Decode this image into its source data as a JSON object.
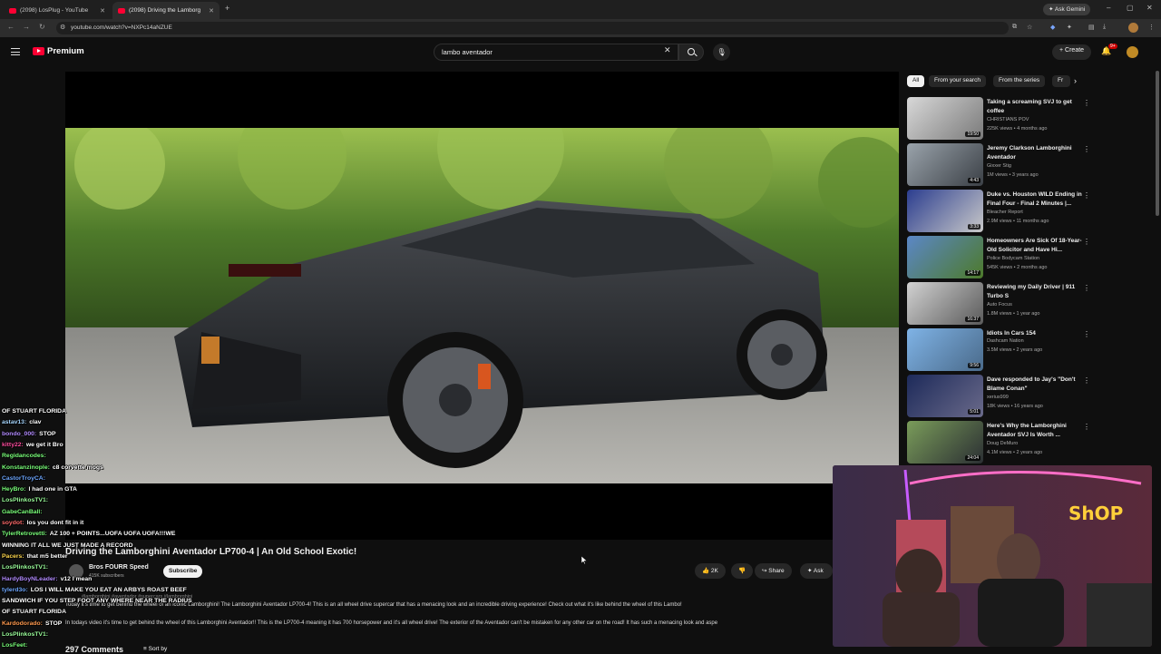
{
  "browser": {
    "tabs": [
      {
        "label": "(2098) LosPlug - YouTube",
        "active": false
      },
      {
        "label": "(2098) Driving the Lamborg",
        "active": true
      }
    ],
    "url": "youtube.com/watch?v=NXPc14aNZUE",
    "ask_gemini": "Ask Gemini"
  },
  "youtube": {
    "logo_text": "Premium",
    "search_value": "lambo aventador",
    "create_label": "Create",
    "notification_count": "9+"
  },
  "chips": [
    "All",
    "From your search",
    "From the series",
    "Fr"
  ],
  "recommendations": [
    {
      "title": "Taking a screaming SVJ to get coffee",
      "channel": "CHRISTIANS POV",
      "meta": "225K views • 4 months ago",
      "duration": "19:50"
    },
    {
      "title": "Jeremy Clarkson Lamborghini Aventador",
      "channel": "Gixxer Stig",
      "meta": "1M views • 3 years ago",
      "duration": "4:43"
    },
    {
      "title": "Duke vs. Houston WILD Ending in Final Four - Final 2 Minutes |...",
      "channel": "Bleacher Report",
      "meta": "2.9M views • 11 months ago",
      "duration": "3:33"
    },
    {
      "title": "Homeowners Are Sick Of 18-Year-Old Solicitor and Have Hi...",
      "channel": "Police Bodycam Station",
      "meta": "545K views • 2 months ago",
      "duration": "14:17"
    },
    {
      "title": "Reviewing my Daily Driver | 911 Turbo S",
      "channel": "Auto Focus",
      "meta": "1.8M views • 1 year ago",
      "duration": "16:37"
    },
    {
      "title": "Idiots In Cars 154",
      "channel": "Dashcam Nation",
      "meta": "3.5M views • 2 years ago",
      "duration": "9:56"
    },
    {
      "title": "Dave responded to Jay's \"Don't Blame Conan\"",
      "channel": "xerius999",
      "meta": "18K views • 16 years ago",
      "duration": "5:01"
    },
    {
      "title": "Here's Why the Lamborghini Aventador SVJ Is Worth ...",
      "channel": "Doug DeMuro",
      "meta": "4.1M views • 2 years ago",
      "duration": "24:04"
    }
  ],
  "video": {
    "title": "Driving the Lamborghini Aventador LP700-4 | An Old School Exotic!",
    "channel": "Bros FOURR Speed",
    "subscribers": "415K subscribers",
    "subscribe_label": "Subscribe",
    "likes": "2K",
    "share_label": "Share",
    "ask_label": "Ask",
    "tags": "#lamborghini #aventador #supercars #lamborghini",
    "desc_line1": "Today it's time to get behind the wheel of an iconic Lamborghini! The Lamborghini Aventador LP700-4! This is an all wheel drive supercar that has a menacing look and an incredible driving experience! Check out what it's like behind the wheel of this Lambo!",
    "desc_line2": "In todays video it's time to get behind the wheel of this Lamborghini Aventador!! This is the LP700-4 meaning it has 700 horsepower and it's all wheel drive! The exterior of the Aventador can't be mistaken for any other car on the road! It has such a menacing look and aspe",
    "comments_count": "297 Comments",
    "sort_label": "Sort by"
  },
  "chat": [
    {
      "user": "",
      "msg": "OF STUART FLORIDA",
      "color": "#ffffff"
    },
    {
      "user": "astav13:",
      "msg": "clav",
      "color": "#a8d7ff"
    },
    {
      "user": "bondo_000:",
      "msg": "STOP",
      "color": "#b38cff"
    },
    {
      "user": "kitty22:",
      "msg": "we get it Bro",
      "color": "#ff4fa0"
    },
    {
      "user": "Regidancodes:",
      "msg": "",
      "color": "#7bff7b"
    },
    {
      "user": "Konstanzinople:",
      "msg": "c8 corvette mogs",
      "color": "#7bff7b"
    },
    {
      "user": "CastorTroyCA:",
      "msg": "",
      "color": "#6fa8ff"
    },
    {
      "user": "HeyBro:",
      "msg": "I had one in GTA",
      "color": "#7bff7b"
    },
    {
      "user": "LosPlinkosTV1:",
      "msg": "",
      "color": "#9cff9c"
    },
    {
      "user": "GabeCanBall:",
      "msg": "",
      "color": "#7bff7b"
    },
    {
      "user": "soydot:",
      "msg": "los you dont fit in it",
      "color": "#ff6b6b"
    },
    {
      "user": "TylerRetrovetti:",
      "msg": "AZ 100 + POINTS...UOFA UOFA UOFA!!!WE",
      "color": "#7bff7b"
    },
    {
      "user": "",
      "msg": "WINNING IT ALL WE JUST MADE A RECORD",
      "color": "#ffffff"
    },
    {
      "user": "Pacers:",
      "msg": "that m5 better",
      "color": "#ffd84f"
    },
    {
      "user": "LosPlinkosTV1:",
      "msg": "",
      "color": "#9cff9c"
    },
    {
      "user": "HardyBoyNLeader:",
      "msg": "v12 I mean",
      "color": "#b38cff"
    },
    {
      "user": "tylerd3o:",
      "msg": "LOS I WILL MAKE YOU EAT AN ARBYS ROAST BEEF",
      "color": "#6fa8ff"
    },
    {
      "user": "",
      "msg": "SANDWICH IF YOU STEP FOOT ANY WHERE NEAR THE RADIUS",
      "color": "#ffffff"
    },
    {
      "user": "",
      "msg": "OF STUART FLORIDA",
      "color": "#ffffff"
    },
    {
      "user": "Kardodorado:",
      "msg": "STOP",
      "color": "#ff9a4f"
    },
    {
      "user": "LosPlinkosTV1:",
      "msg": "",
      "color": "#9cff9c"
    },
    {
      "user": "LosFeet:",
      "msg": "",
      "color": "#7bff7b"
    }
  ]
}
